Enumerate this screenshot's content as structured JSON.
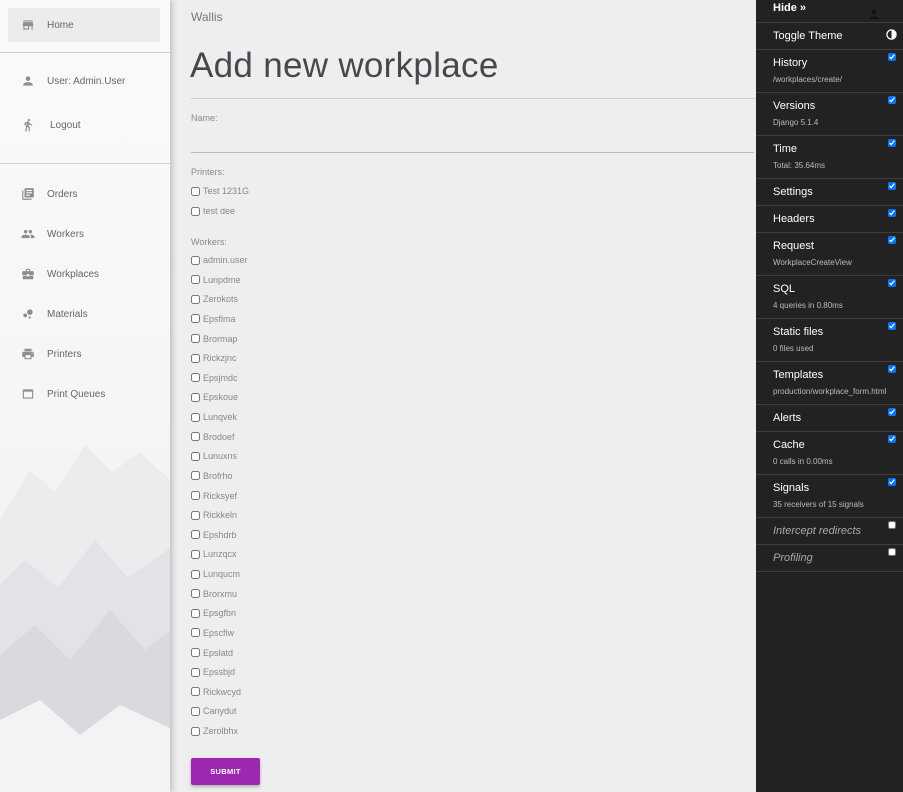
{
  "app": {
    "name": "Wallis"
  },
  "sidebar": {
    "items": [
      {
        "label": "Home",
        "icon": "store-icon"
      },
      {
        "label": "User: Admin.User",
        "icon": "person-icon"
      },
      {
        "label": "Logout",
        "icon": "run-icon"
      },
      {
        "label": "Orders",
        "icon": "library-books-icon"
      },
      {
        "label": "Workers",
        "icon": "people-icon"
      },
      {
        "label": "Workplaces",
        "icon": "briefcase-icon"
      },
      {
        "label": "Materials",
        "icon": "bubble-chart-icon"
      },
      {
        "label": "Printers",
        "icon": "printer-icon"
      },
      {
        "label": "Print Queues",
        "icon": "web-asset-icon"
      }
    ]
  },
  "form": {
    "title": "Add new workplace",
    "name_label": "Name:",
    "name_value": "",
    "printers_label": "Printers:",
    "printers": [
      "Test 1231G",
      "test dee"
    ],
    "workers_label": "Workers:",
    "workers": [
      "admin.user",
      "Lunpdme",
      "Zerokots",
      "Epsfima",
      "Brormap",
      "Rickzjnc",
      "Epsjmdc",
      "Epskoue",
      "Lunqvek",
      "Brodoef",
      "Lunuxns",
      "Brofrho",
      "Ricksyef",
      "Rickkeln",
      "Epshdrb",
      "Lunzqcx",
      "Lunqucm",
      "Brorxmu",
      "Epsgfbn",
      "Epscfiw",
      "Epslatd",
      "Epssbjd",
      "Rickwcyd",
      "Canydut",
      "Zerolbhx"
    ],
    "submit_label": "SUBMIT"
  },
  "djdt": {
    "hide_label": "Hide »",
    "panels": [
      {
        "title": "Toggle Theme",
        "sub": ""
      },
      {
        "title": "History",
        "sub": "/workplaces/create/"
      },
      {
        "title": "Versions",
        "sub": "Django 5.1.4"
      },
      {
        "title": "Time",
        "sub": "Total: 35.64ms"
      },
      {
        "title": "Settings",
        "sub": ""
      },
      {
        "title": "Headers",
        "sub": ""
      },
      {
        "title": "Request",
        "sub": "WorkplaceCreateView"
      },
      {
        "title": "SQL",
        "sub": "4 queries in 0.80ms"
      },
      {
        "title": "Static files",
        "sub": "0 files used"
      },
      {
        "title": "Templates",
        "sub": "production/workplace_form.html"
      },
      {
        "title": "Alerts",
        "sub": ""
      },
      {
        "title": "Cache",
        "sub": "0 calls in 0.00ms"
      },
      {
        "title": "Signals",
        "sub": "35 receivers of 15 signals"
      },
      {
        "title": "Intercept redirects",
        "sub": ""
      },
      {
        "title": "Profiling",
        "sub": ""
      }
    ]
  },
  "colors": {
    "accent": "#9c27b0",
    "toolbar_bg": "#222222"
  }
}
